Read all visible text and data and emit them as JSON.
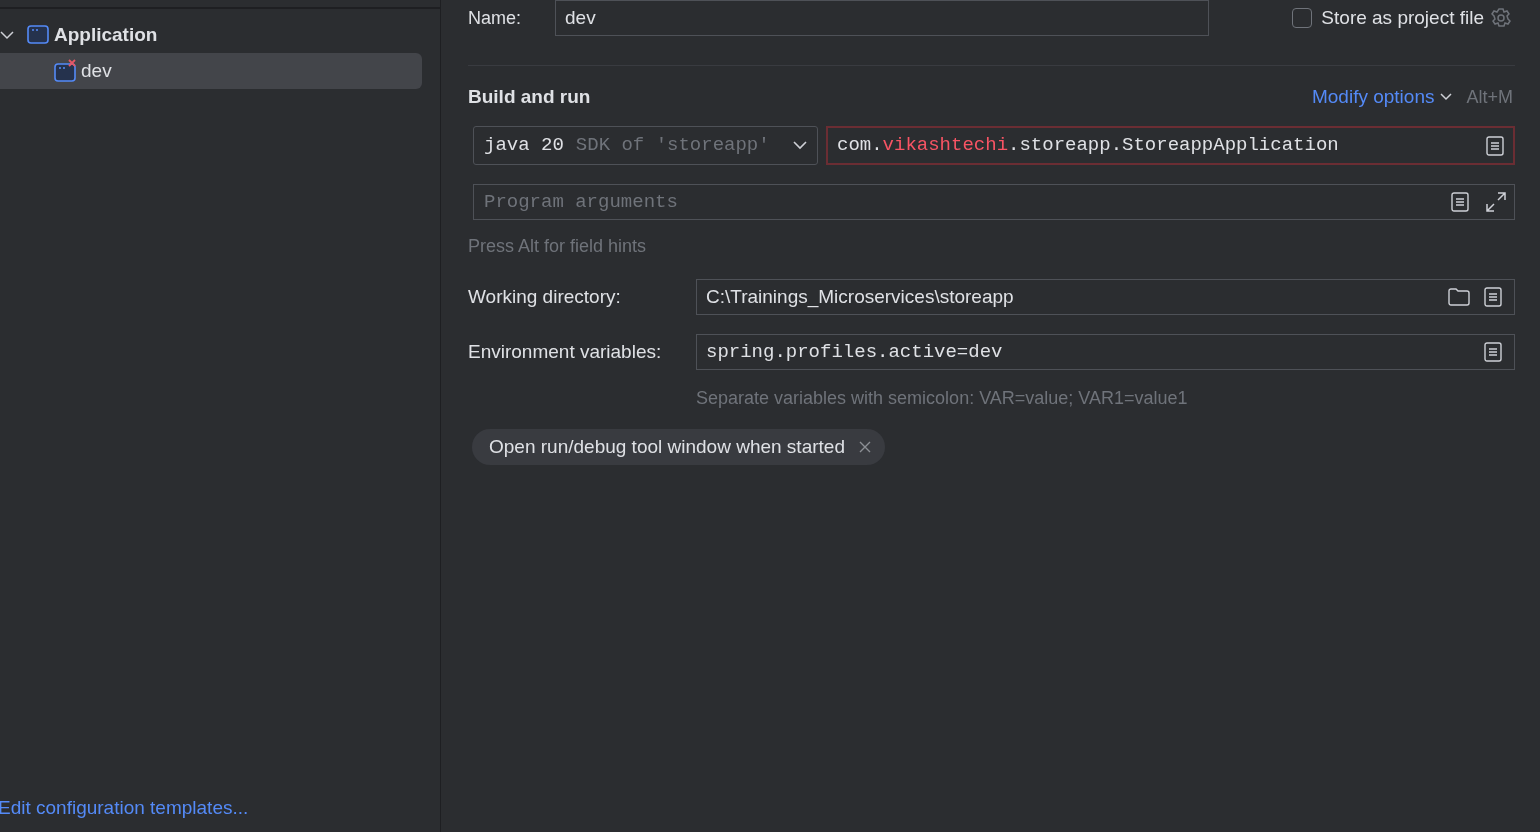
{
  "sidebar": {
    "tree": [
      {
        "label": "Application",
        "expanded": true,
        "selected": false,
        "children": [
          {
            "label": "dev",
            "selected": true,
            "error": true
          }
        ]
      }
    ],
    "footer_link": "Edit configuration templates..."
  },
  "name_field": {
    "label": "Name:",
    "value": "dev"
  },
  "store_as_project_file": {
    "label": "Store as project file",
    "checked": false
  },
  "section": {
    "title": "Build and run",
    "modify_options": "Modify options",
    "shortcut": "Alt+M"
  },
  "sdk": {
    "value": "java 20",
    "detail": "SDK of 'storeapp'"
  },
  "main_class": {
    "error": true,
    "parts": [
      {
        "text": "com.",
        "error": false
      },
      {
        "text": "vikashtechi",
        "error": true
      },
      {
        "text": ".storeapp.StoreappApplication",
        "error": false
      }
    ]
  },
  "program_arguments": {
    "placeholder": "Program arguments"
  },
  "field_hint": "Press Alt for field hints",
  "working_directory": {
    "label": "Working directory:",
    "value": "C:\\Trainings_Microservices\\storeapp"
  },
  "environment_variables": {
    "label": "Environment variables:",
    "value": "spring.profiles.active=dev",
    "hint": "Separate variables with semicolon: VAR=value; VAR1=value1"
  },
  "options": [
    {
      "label": "Open run/debug tool window when started"
    }
  ]
}
